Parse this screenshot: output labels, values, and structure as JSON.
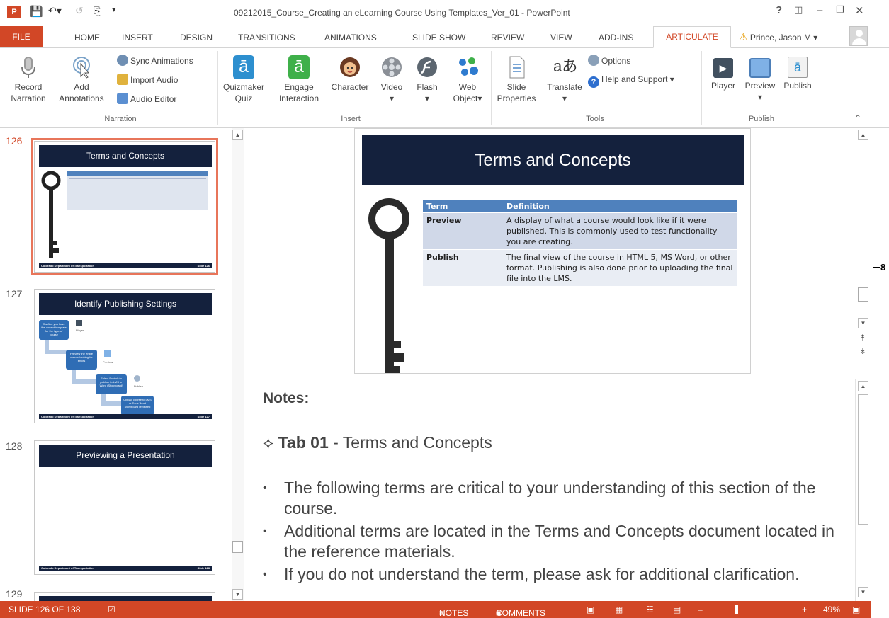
{
  "window": {
    "title": "09212015_Course_Creating an eLearning Course Using Templates_Ver_01 - PowerPoint",
    "help": "?",
    "minimize": "–",
    "close": "✕"
  },
  "tabs": [
    "FILE",
    "HOME",
    "INSERT",
    "DESIGN",
    "TRANSITIONS",
    "ANIMATIONS",
    "SLIDE SHOW",
    "REVIEW",
    "VIEW",
    "ADD-INS",
    "ARTICULATE"
  ],
  "user": {
    "name": "Prince, Jason M"
  },
  "ribbon": {
    "narration": {
      "record_l1": "Record",
      "record_l2": "Narration",
      "annot_l1": "Add",
      "annot_l2": "Annotations",
      "sync": "Sync Animations",
      "import": "Import Audio",
      "editor": "Audio Editor",
      "group": "Narration"
    },
    "insert": {
      "quizmaker_l1": "Quizmaker",
      "quizmaker_l2": "Quiz",
      "engage_l1": "Engage",
      "engage_l2": "Interaction",
      "character": "Character",
      "video": "Video",
      "flash": "Flash",
      "web_l1": "Web",
      "web_l2": "Object",
      "group": "Insert"
    },
    "tools": {
      "slideprops_l1": "Slide",
      "slideprops_l2": "Properties",
      "translate": "Translate",
      "options": "Options",
      "help": "Help and Support",
      "group": "Tools"
    },
    "publish": {
      "player": "Player",
      "preview": "Preview",
      "publish": "Publish",
      "group": "Publish"
    }
  },
  "thumbnails": [
    {
      "num": "126",
      "title": "Terms and Concepts",
      "footer_left": "Colorado Department of Transportation",
      "footer_right": "Slide 126"
    },
    {
      "num": "127",
      "title": "Identify Publishing Settings",
      "footer_left": "Colorado Department of Transportation",
      "footer_right": "Slide 127"
    },
    {
      "num": "128",
      "title": "Previewing a Presentation",
      "footer_left": "Colorado Department of Transportation",
      "footer_right": "Slide 128"
    },
    {
      "num": "129"
    }
  ],
  "thumb127_steps": [
    "Confirm you have the correct template for the type of course",
    "Preview the entire course looking for errors",
    "Select Publish to publish to LMS or Word (Storyboard)",
    "Upload course to LMS or Save Word Storyboard reviewed"
  ],
  "thumb127_labels": [
    "Player",
    "Preview",
    "Publish"
  ],
  "slide": {
    "title": "Terms and Concepts",
    "table": {
      "headers": [
        "Term",
        "Definition"
      ],
      "rows": [
        {
          "term": "Preview",
          "def": "A display of what a course would look like if it were published.  This is commonly used to test functionality you are creating."
        },
        {
          "term": "Publish",
          "def": "The final view of the course in HTML 5, MS Word, or other format.  Publishing is also done prior to uploading the final file into the LMS."
        }
      ]
    }
  },
  "notes": {
    "heading": "Notes:",
    "tab_label": "Tab 01",
    "tab_rest": " - Terms and Concepts",
    "bullets": [
      "The following terms are critical to your understanding of this section of the course.",
      "Additional terms are located in the Terms and Concepts document located in the reference materials.",
      "If you do not understand the term, please ask for additional clarification."
    ]
  },
  "status": {
    "slide": "SLIDE 126 OF 138",
    "notes": "NOTES",
    "comments": "COMMENTS",
    "zoom": "49%"
  },
  "annotation": "8",
  "colors": {
    "accent": "#d24726",
    "slide_header": "#14213d",
    "table_header": "#4f81bd"
  }
}
